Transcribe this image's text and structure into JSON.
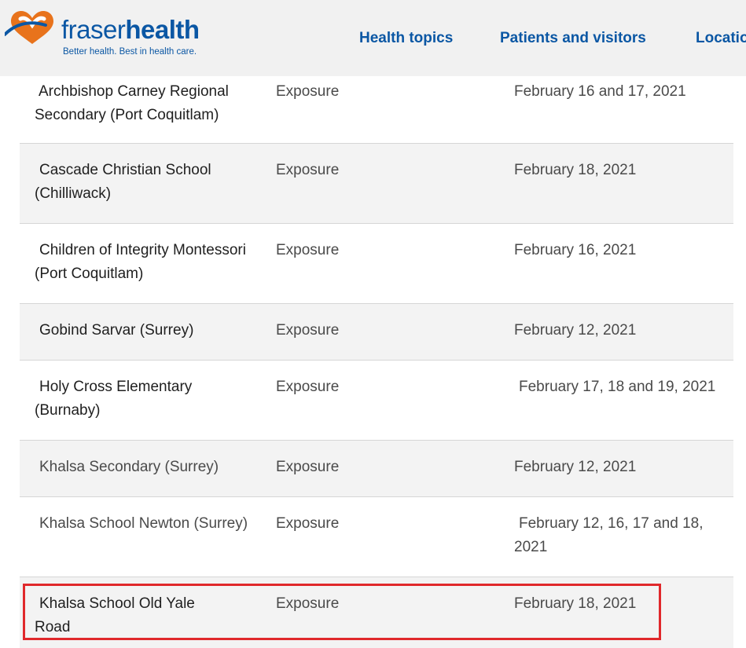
{
  "header": {
    "logo_light": "fraser",
    "logo_bold": "health",
    "tagline": "Better health. Best in health care.",
    "nav": [
      "Health topics",
      "Patients and visitors",
      "Locatio"
    ]
  },
  "colors": {
    "brand_blue": "#0b57a4",
    "logo_orange": "#e8731c",
    "highlight_red": "#e0282b"
  },
  "rows": [
    {
      "name": "Archbishop Carney Regional Secondary (Port Coquitlam)",
      "type": "Exposure",
      "dates": "February 16 and 17, 2021"
    },
    {
      "name": "Cascade Christian School (Chilliwack)",
      "type": "Exposure",
      "dates": "February 18, 2021"
    },
    {
      "name": "Children of Integrity Montessori (Port Coquitlam)",
      "type": "Exposure",
      "dates": "February 16, 2021"
    },
    {
      "name": "Gobind Sarvar (Surrey)",
      "type": "Exposure",
      "dates": "February 12, 2021"
    },
    {
      "name": "Holy Cross Elementary (Burnaby)",
      "type": "Exposure",
      "dates": "February 17, 18 and 19, 2021"
    },
    {
      "name": "Khalsa Secondary (Surrey)",
      "type": "Exposure",
      "dates": "February 12, 2021"
    },
    {
      "name": "Khalsa School Newton (Surrey)",
      "type": "Exposure",
      "dates": "February 12, 16, 17 and 18, 2021"
    },
    {
      "name": "Khalsa School Old Yale Road",
      "type": "Exposure",
      "dates": "February 18, 2021"
    }
  ]
}
